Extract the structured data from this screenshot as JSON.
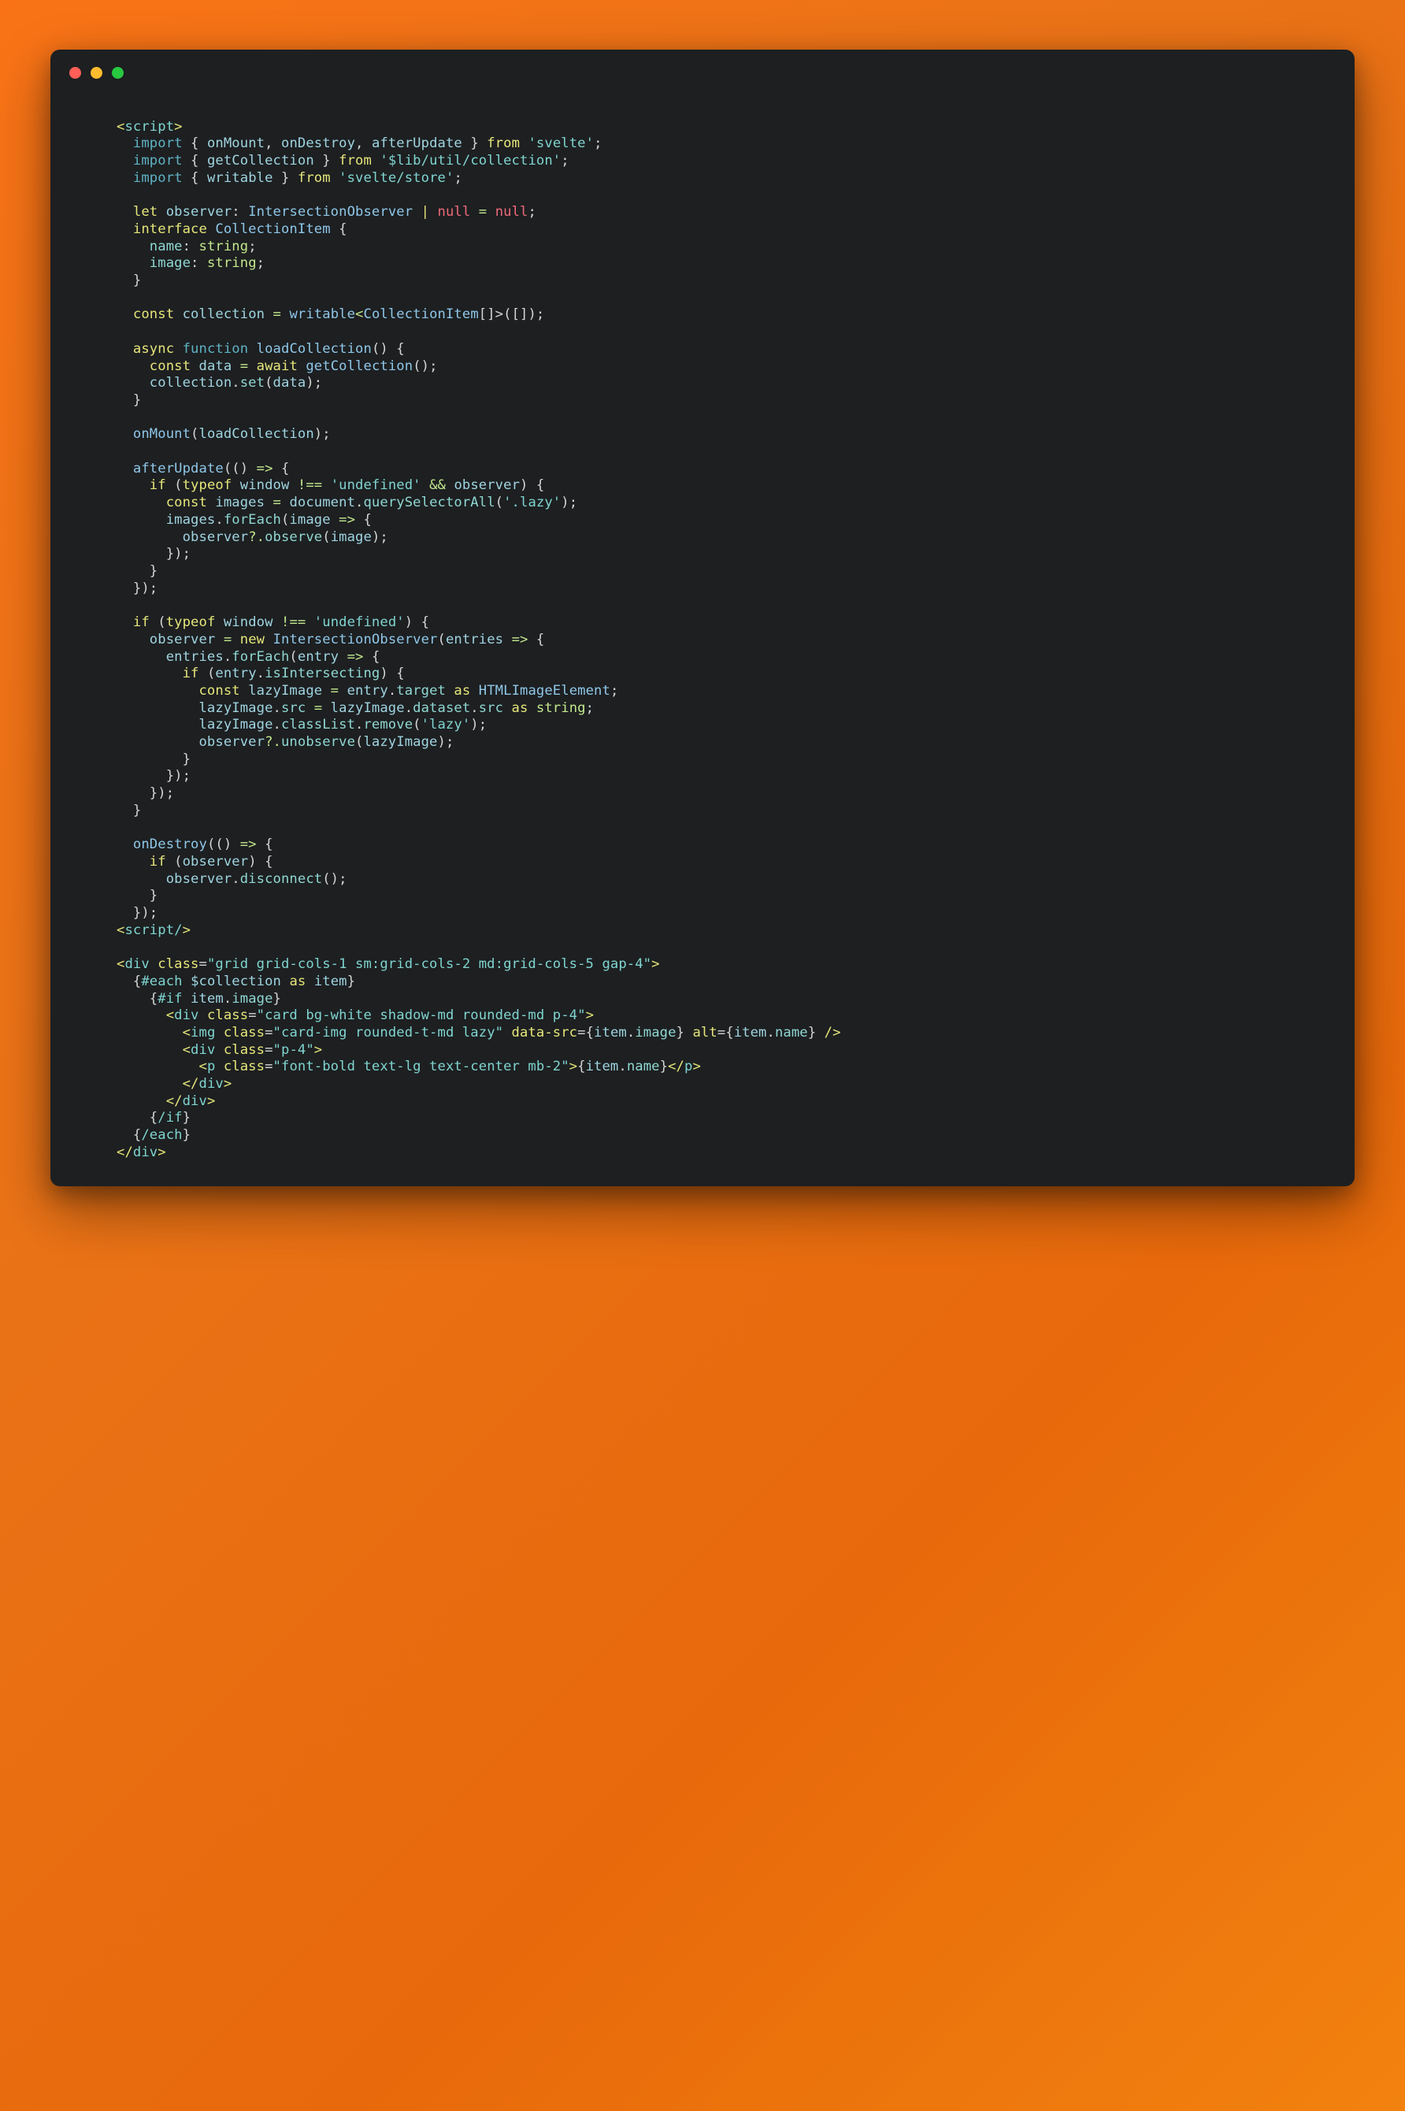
{
  "window": {
    "title": "",
    "controls": [
      {
        "name": "close",
        "color": "#ff5f57"
      },
      {
        "name": "minimize",
        "color": "#febc2e"
      },
      {
        "name": "zoom",
        "color": "#28c840"
      }
    ],
    "background_color": "#1d1f21",
    "page_background": "#f97316"
  },
  "editor": {
    "language": "svelte",
    "theme": "dark",
    "font_size_px": 17,
    "line_height_px": 22,
    "colors": {
      "background": "#1d1f21",
      "foreground": "#c5c8c6",
      "keyword": "#e6e67a",
      "function": "#5fb3c4",
      "identifier": "#9fd4e0",
      "type": "#8fc7e8",
      "string": "#7fd4cf",
      "operator": "#c3e88d",
      "literal": "#f0697a",
      "punctuation": "#d4d7d6"
    }
  },
  "code": {
    "lines": [
      "<script>",
      "  import { onMount, onDestroy, afterUpdate } from 'svelte';",
      "  import { getCollection } from '$lib/util/collection';",
      "  import { writable } from 'svelte/store';",
      "",
      "  let observer: IntersectionObserver | null = null;",
      "  interface CollectionItem {",
      "    name: string;",
      "    image: string;",
      "  }",
      "",
      "  const collection = writable<CollectionItem[]>([]);",
      "",
      "  async function loadCollection() {",
      "    const data = await getCollection();",
      "    collection.set(data);",
      "  }",
      "",
      "  onMount(loadCollection);",
      "",
      "  afterUpdate(() => {",
      "    if (typeof window !== 'undefined' && observer) {",
      "      const images = document.querySelectorAll('.lazy');",
      "      images.forEach(image => {",
      "        observer?.observe(image);",
      "      });",
      "    }",
      "  });",
      "",
      "  if (typeof window !== 'undefined') {",
      "    observer = new IntersectionObserver(entries => {",
      "      entries.forEach(entry => {",
      "        if (entry.isIntersecting) {",
      "          const lazyImage = entry.target as HTMLImageElement;",
      "          lazyImage.src = lazyImage.dataset.src as string;",
      "          lazyImage.classList.remove('lazy');",
      "          observer?.unobserve(lazyImage);",
      "        }",
      "      });",
      "    });",
      "  }",
      "",
      "  onDestroy(() => {",
      "    if (observer) {",
      "      observer.disconnect();",
      "    }",
      "  });",
      "<script/>",
      "",
      "<div class=\"grid grid-cols-1 sm:grid-cols-2 md:grid-cols-5 gap-4\">",
      "  {#each $collection as item}",
      "    {#if item.image}",
      "      <div class=\"card bg-white shadow-md rounded-md p-4\">",
      "        <img class=\"card-img rounded-t-md lazy\" data-src={item.image} alt={item.name} />",
      "        <div class=\"p-4\">",
      "          <p class=\"font-bold text-lg text-center mb-2\">{item.name}</p>",
      "        </div>",
      "      </div>",
      "    {/if}",
      "  {/each}",
      "</div>"
    ]
  }
}
